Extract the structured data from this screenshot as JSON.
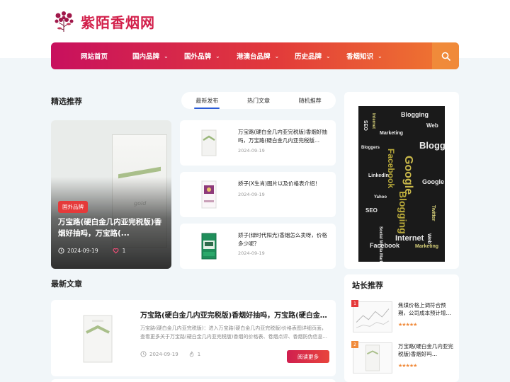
{
  "site": {
    "name": "紫陌香烟网"
  },
  "nav": {
    "items": [
      {
        "label": "网站首页",
        "has_dropdown": false
      },
      {
        "label": "国内品牌",
        "has_dropdown": true
      },
      {
        "label": "国外品牌",
        "has_dropdown": true
      },
      {
        "label": "港澳台品牌",
        "has_dropdown": true
      },
      {
        "label": "历史品牌",
        "has_dropdown": true
      },
      {
        "label": "香烟知识",
        "has_dropdown": true
      }
    ],
    "search_icon": "search-icon"
  },
  "featured": {
    "title": "精选推荐",
    "tabs": [
      {
        "label": "最新发布",
        "active": true
      },
      {
        "label": "热门文章",
        "active": false
      },
      {
        "label": "随机推荐",
        "active": false
      }
    ],
    "main": {
      "badge": "国外品牌",
      "title": "万宝路(硬白金几内亚完税版)香烟好抽吗，万宝路(...",
      "date": "2024-09-19",
      "likes": "1"
    },
    "list": [
      {
        "title": "万宝路(硬白金几内亚完税版)香烟好抽吗，万宝路(硬白金几内亚完税版...",
        "date": "2024-09-19"
      },
      {
        "title": "娇子(X生肖)图片以及价格表介绍！",
        "date": "2024-09-19"
      },
      {
        "title": "娇子(绿时代阳光)香烟怎么卖呀，价格多少呢？",
        "date": "2024-09-19"
      }
    ]
  },
  "latest": {
    "title": "最新文章",
    "item": {
      "title": "万宝路(硬白金几内亚完税版)香烟好抽吗，万宝路(硬白金...",
      "excerpt": "万宝路(硬白金几内亚完税版)：进入万宝路(硬白金几内亚完税版)价格表图详细页面，查看更多关于万宝路(硬白金几内亚完税版)香烟的价格表、卷烟点评、香烟防伪信息...",
      "date": "2024-09-19",
      "likes": "1",
      "button": "阅读更多"
    }
  },
  "sidebar": {
    "ad_words": [
      "SEO",
      "Internet",
      "Marketing",
      "Facebook",
      "Blogging",
      "Google",
      "Bloggers",
      "Web",
      "LinkedIn",
      "Yahoo",
      "Twitter",
      "Social Media Marketing"
    ],
    "recommend": {
      "title": "站长推荐",
      "items": [
        {
          "rank": "1",
          "title": "焦煤价格上调符合预期，公司成本预计增...",
          "stars": "★★★★★"
        },
        {
          "rank": "2",
          "title": "万宝路(硬白金几内亚完税版)香烟好吗...",
          "stars": "★★★★★"
        }
      ]
    }
  },
  "colors": {
    "brand_red": "#d21f4a",
    "nav_gradient_start": "#c8105e",
    "nav_gradient_end": "#f07a30",
    "accent_blue": "#2a5bd7",
    "star": "#f08a3a"
  }
}
